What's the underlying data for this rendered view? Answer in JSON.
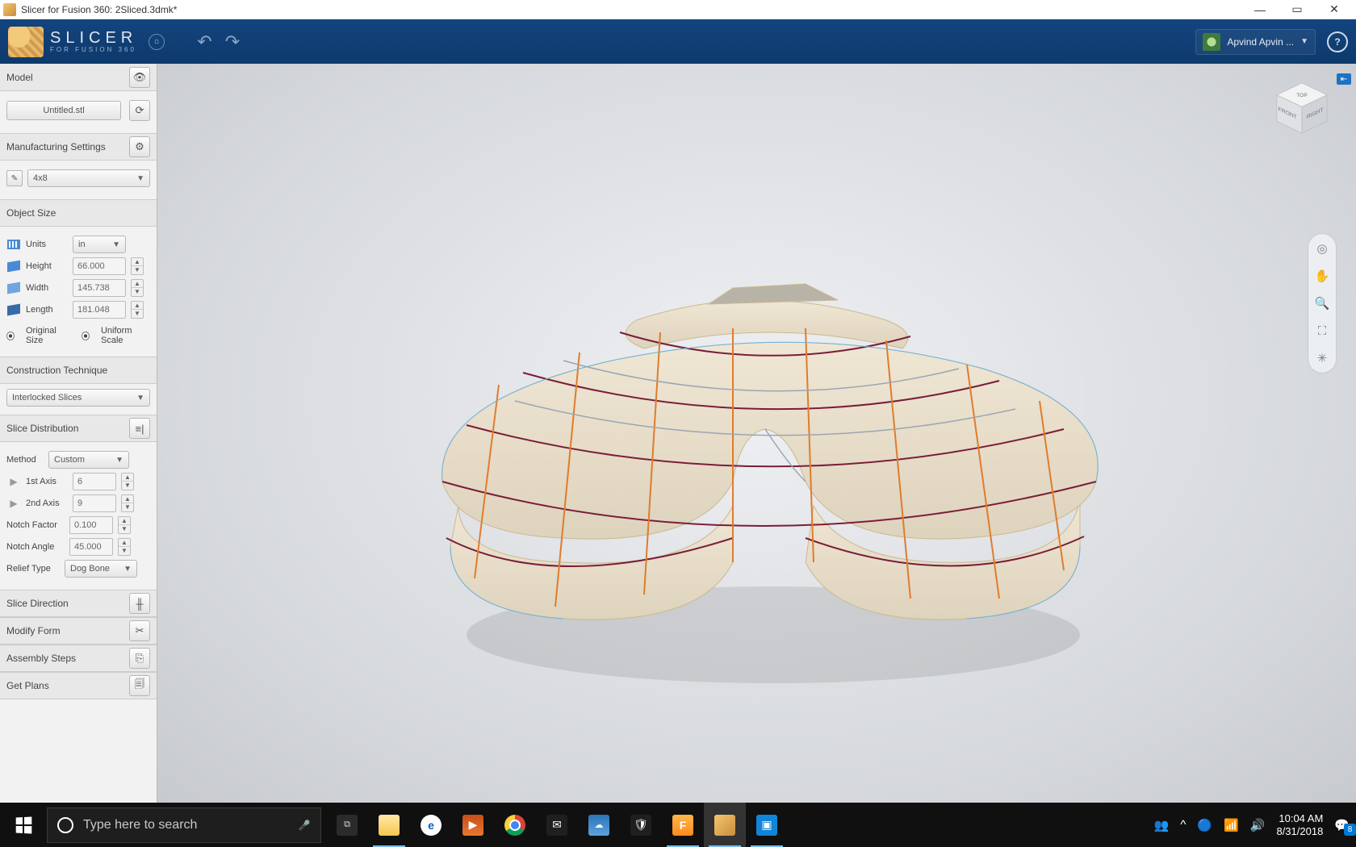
{
  "window": {
    "title": "Slicer for Fusion 360: 2Sliced.3dmk*",
    "min": "—",
    "max": "▭",
    "close": "✕"
  },
  "ribbon": {
    "app_name": "SLICER",
    "app_sub": "FOR FUSION 360",
    "home_glyph": "⌂",
    "undo_glyph": "↶",
    "redo_glyph": "↷",
    "user_name": "Apvind Apvin ...",
    "user_caret": "▼",
    "help_glyph": "?"
  },
  "sections": {
    "model": {
      "label": "Model",
      "file_name": "Untitled.stl",
      "eye_glyph": "👁",
      "refresh_glyph": "⟳"
    },
    "manufacturing": {
      "label": "Manufacturing Settings",
      "gear_glyph": "⚙",
      "pencil_glyph": "✎",
      "value": "4x8",
      "caret": "▼"
    },
    "object_size": {
      "label": "Object Size",
      "units_label": "Units",
      "units_value": "in",
      "units_caret": "▼",
      "height_label": "Height",
      "height_value": "66.000",
      "width_label": "Width",
      "width_value": "145.738",
      "length_label": "Length",
      "length_value": "181.048",
      "spin_up": "▲",
      "spin_down": "▼",
      "original": "Original Size",
      "uniform": "Uniform Scale"
    },
    "construction": {
      "label": "Construction Technique",
      "value": "Interlocked Slices",
      "caret": "▼"
    },
    "slice_distribution": {
      "label": "Slice Distribution",
      "tool_glyph": "≡|",
      "method_label": "Method",
      "method_value": "Custom",
      "method_caret": "▼",
      "axis1_label": "1st Axis",
      "axis1_value": "6",
      "axis2_label": "2nd Axis",
      "axis2_value": "9",
      "play_glyph": "▶",
      "notch_factor_label": "Notch Factor",
      "notch_factor_value": "0.100",
      "notch_angle_label": "Notch Angle",
      "notch_angle_value": "45.000",
      "relief_label": "Relief Type",
      "relief_value": "Dog Bone",
      "relief_caret": "▼"
    },
    "slice_direction": {
      "label": "Slice Direction",
      "tool_glyph": "╫"
    },
    "modify_form": {
      "label": "Modify Form",
      "tool_glyph": "✂"
    },
    "assembly_steps": {
      "label": "Assembly Steps",
      "tool_glyph": "⎘"
    },
    "get_plans": {
      "label": "Get Plans",
      "tool_glyph": "🗐"
    }
  },
  "viewport": {
    "cube": {
      "top": "TOP",
      "front": "FRONT",
      "right": "RIGHT"
    },
    "collapse": "⇤",
    "nav": {
      "orbit": "◎",
      "pan": "✋",
      "zoom": "🔍",
      "fit": "⛶",
      "look": "✳"
    }
  },
  "taskbar": {
    "search_placeholder": "Type here to search",
    "mic": "🎤",
    "taskview": "⧉",
    "icons": {
      "folder": "📁",
      "edge": "e",
      "movies": "▶",
      "chrome": "",
      "mail": "✉",
      "weather": "☁",
      "security": "🛡",
      "fusion": "F",
      "slicer": "",
      "photos": "▣"
    },
    "tray": {
      "people": "👥",
      "up": "^",
      "net": "📶",
      "vol": "🔊",
      "bt": "🔵",
      "wifi": "📡",
      "time": "10:04 AM",
      "date": "8/31/2018",
      "action": "💬"
    }
  }
}
